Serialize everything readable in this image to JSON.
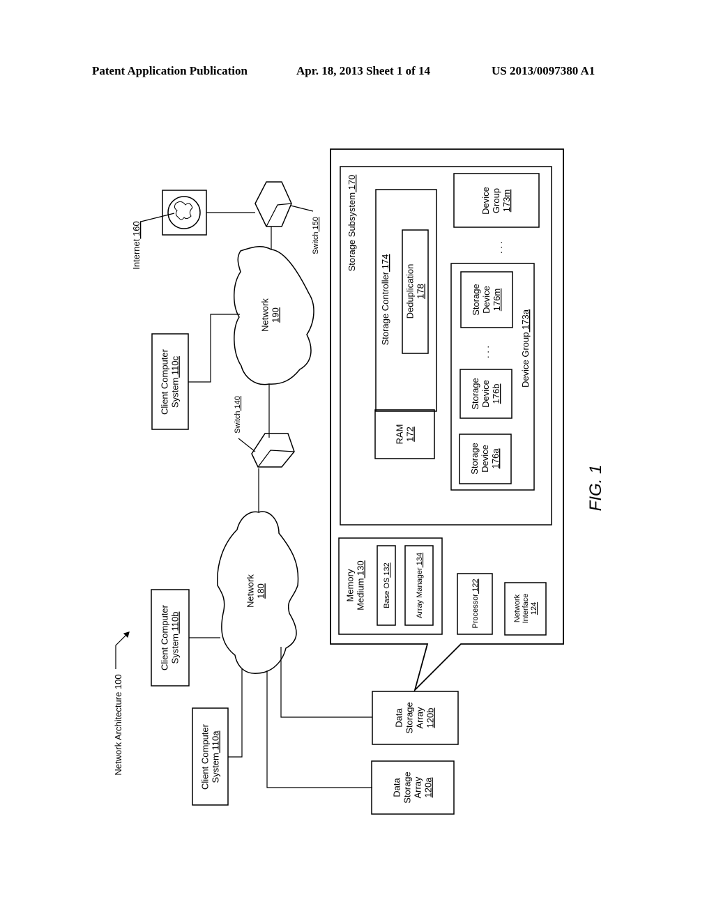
{
  "header": {
    "publication": "Patent Application Publication",
    "date_sheet": "Apr. 18, 2013  Sheet 1 of 14",
    "number": "US 2013/0097380 A1"
  },
  "figure_label": "FIG. 1",
  "architecture_label": "Network Architecture 100",
  "nodes": {
    "internet": {
      "text": "Internet",
      "ref": "160",
      "icon": "globe-icon"
    },
    "switch150": {
      "text": "Switch",
      "ref": "150",
      "icon": "switch-icon"
    },
    "switch140": {
      "text": "Switch",
      "ref": "140",
      "icon": "switch-icon"
    },
    "network190": {
      "text": "Network",
      "ref": "190"
    },
    "network180": {
      "text": "Network",
      "ref": "180"
    },
    "client110c": {
      "line1": "Client Computer",
      "line2": "System",
      "ref": "110c"
    },
    "client110b": {
      "line1": "Client Computer",
      "line2": "System",
      "ref": "110b"
    },
    "client110a": {
      "line1": "Client Computer",
      "line2": "System",
      "ref": "110a"
    },
    "array120b": {
      "line1": "Data",
      "line2": "Storage",
      "line3": "Array",
      "ref": "120b"
    },
    "array120a": {
      "line1": "Data",
      "line2": "Storage",
      "line3": "Array",
      "ref": "120a"
    },
    "storage_subsystem": {
      "text": "Storage Subsystem",
      "ref": "170"
    },
    "storage_controller": {
      "text": "Storage Controller",
      "ref": "174"
    },
    "deduplication": {
      "text": "Deduplication",
      "ref": "178"
    },
    "ram": {
      "text": "RAM",
      "ref": "172"
    },
    "device_group_m": {
      "line1": "Device",
      "line2": "Group",
      "ref": "173m"
    },
    "device_group_a": {
      "text": "Device Group",
      "ref": "173a"
    },
    "storage_device_a": {
      "line1": "Storage",
      "line2": "Device",
      "ref": "176a"
    },
    "storage_device_b": {
      "line1": "Storage",
      "line2": "Device",
      "ref": "176b"
    },
    "storage_device_m": {
      "line1": "Storage",
      "line2": "Device",
      "ref": "176m"
    },
    "memory_medium": {
      "line1": "Memory",
      "line2": "Medium",
      "ref": "130"
    },
    "base_os": {
      "text": "Base OS",
      "ref": "132"
    },
    "array_manager": {
      "text": "Array Manager",
      "ref": "134"
    },
    "processor": {
      "text": "Processor",
      "ref": "122"
    },
    "network_interface": {
      "line1": "Network",
      "line2": "Interface",
      "ref": "124"
    }
  },
  "ellipsis": ". . ."
}
